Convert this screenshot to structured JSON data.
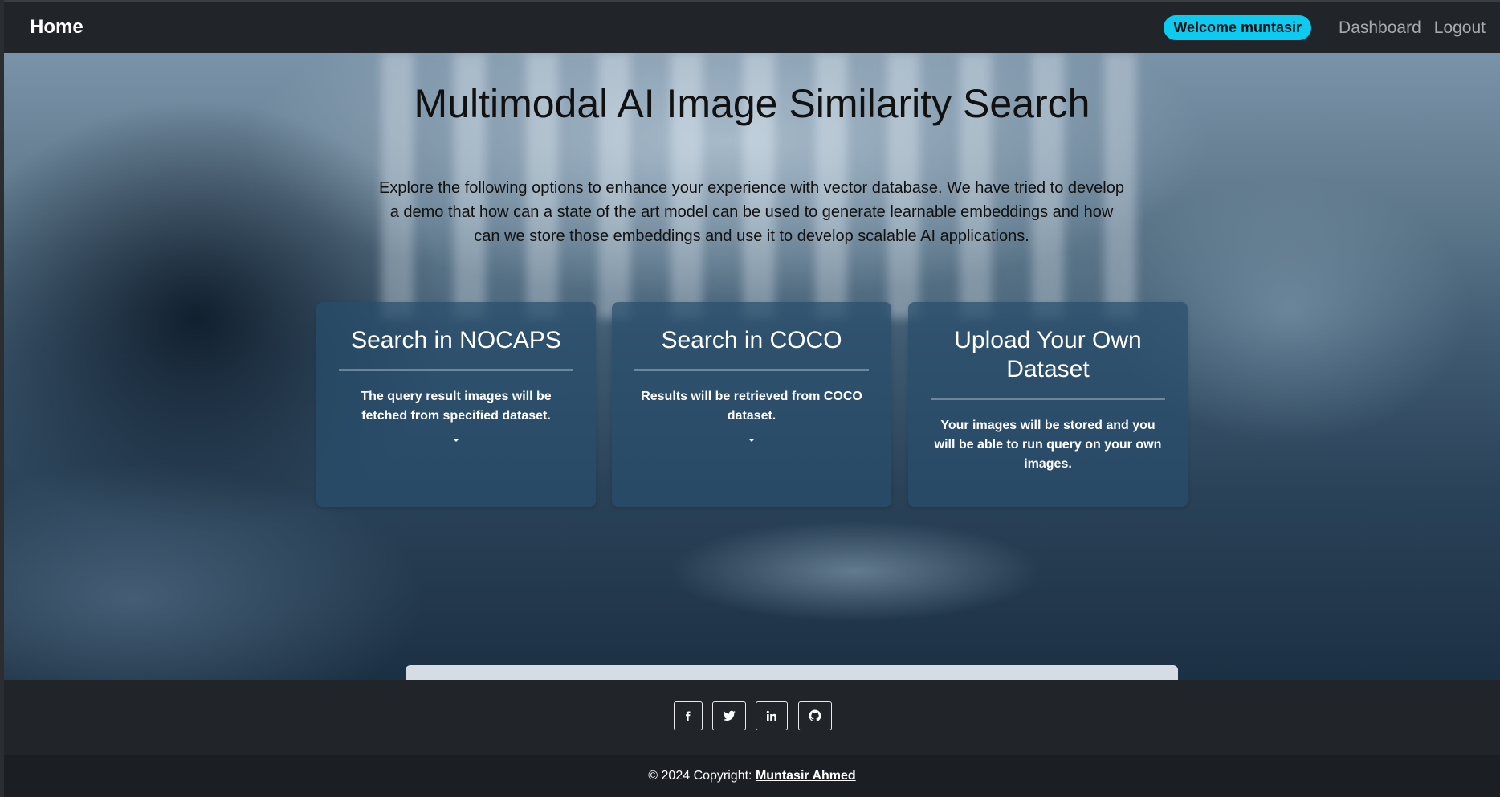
{
  "navbar": {
    "brand": "Home",
    "welcome": "Welcome muntasir",
    "links": [
      "Dashboard",
      "Logout"
    ]
  },
  "hero": {
    "title": "Multimodal AI Image Similarity Search",
    "description": "Explore the following options to enhance your experience with vector database. We have tried to develop a demo that how can a state of the art model can be used to generate learnable embeddings and how can we store those embeddings and use it to develop scalable AI applications."
  },
  "cards": [
    {
      "title": "Search in NOCAPS",
      "text": "The query result images will be fetched from specified dataset.",
      "has_dropdown": true
    },
    {
      "title": "Search in COCO",
      "text": "Results will be retrieved from COCO dataset.",
      "has_dropdown": true
    },
    {
      "title": "Upload Your Own Dataset",
      "text": "Your images will be stored and you will be able to run query on your own images.",
      "has_dropdown": false
    }
  ],
  "footer": {
    "social_icons": [
      "facebook-icon",
      "twitter-icon",
      "linkedin-icon",
      "github-icon"
    ],
    "copyright_prefix": "© 2024 Copyright:",
    "copyright_name": "Muntasir Ahmed"
  },
  "colors": {
    "navbar_bg": "#212529",
    "badge_bg": "#0dcaf0",
    "card_bg": "rgba(40,78,108,0.72)"
  }
}
